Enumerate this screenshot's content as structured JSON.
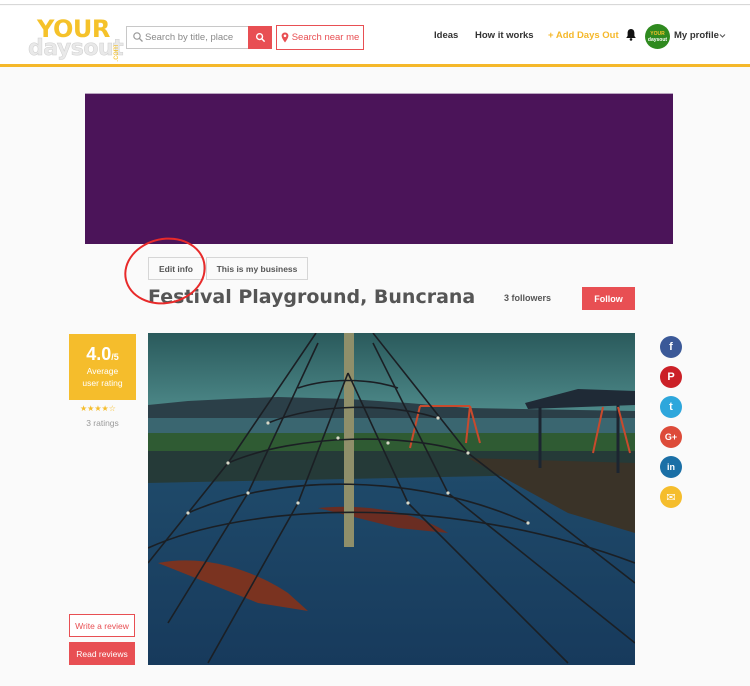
{
  "header": {
    "logo": {
      "line1": "YOUR",
      "line2": "daysout",
      "suffix": ".com"
    },
    "search": {
      "placeholder": "Search by title, place",
      "value": ""
    },
    "search_near_me": "Search near me",
    "nav": [
      "Ideas",
      "How it works",
      "+ Add Days Out"
    ],
    "avatar": {
      "line1": "YOUR",
      "line2": "daysout"
    },
    "profile_label": "My profile"
  },
  "listing": {
    "actions": {
      "edit_info": "Edit info",
      "my_business": "This is my business"
    },
    "title": "Festival Playground, Buncrana",
    "followers": "3 followers",
    "follow_label": "Follow",
    "rating": {
      "score": "4.0",
      "out_of": "/5",
      "label_line1": "Average",
      "label_line2": "user rating",
      "stars_filled": 4,
      "stars_total": 5,
      "stars_text": "★★★★☆",
      "count": "3 ratings"
    },
    "photo_alt": "Rope climbing pyramid at a seaside playground",
    "share": [
      {
        "icon": "facebook-icon",
        "glyph": "f",
        "color": "#3b5998"
      },
      {
        "icon": "pinterest-icon",
        "glyph": "P",
        "color": "#cb2027"
      },
      {
        "icon": "twitter-icon",
        "glyph": "t",
        "color": "#2ea7dc"
      },
      {
        "icon": "google-plus-icon",
        "glyph": "G+",
        "color": "#dd4b39"
      },
      {
        "icon": "linkedin-icon",
        "glyph": "in",
        "color": "#1a6fa6"
      },
      {
        "icon": "email-icon",
        "glyph": "✉",
        "color": "#f5bd2c"
      }
    ],
    "write_review": "Write a review",
    "read_reviews": "Read reviews"
  },
  "colors": {
    "accent_red": "#e84f53",
    "accent_yellow": "#f5b82a",
    "banner_purple": "#4b1459",
    "annotation_circle": "#e82a2a"
  }
}
